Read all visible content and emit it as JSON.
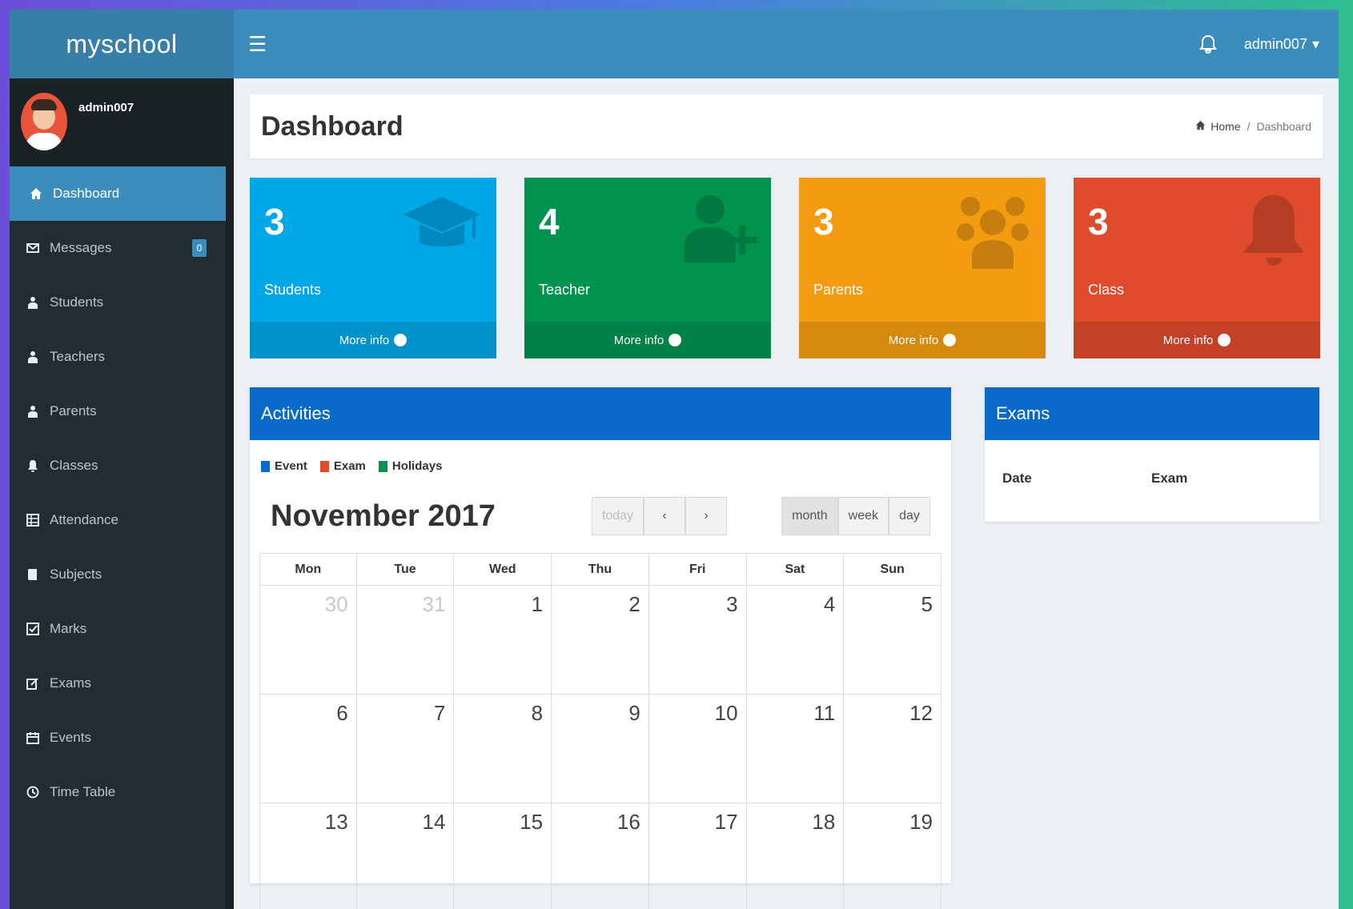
{
  "app": {
    "logo": "myschool"
  },
  "header": {
    "user_label": "admin007"
  },
  "sidebar": {
    "user_name": "admin007",
    "items": [
      {
        "label": "Dashboard",
        "icon": "home-icon",
        "active": true
      },
      {
        "label": "Messages",
        "icon": "envelope-icon",
        "badge": "0"
      },
      {
        "label": "Students",
        "icon": "user-icon"
      },
      {
        "label": "Teachers",
        "icon": "user-icon"
      },
      {
        "label": "Parents",
        "icon": "user-icon"
      },
      {
        "label": "Classes",
        "icon": "bell-icon"
      },
      {
        "label": "Attendance",
        "icon": "table-icon"
      },
      {
        "label": "Subjects",
        "icon": "book-icon"
      },
      {
        "label": "Marks",
        "icon": "check-square-icon"
      },
      {
        "label": "Exams",
        "icon": "edit-icon"
      },
      {
        "label": "Events",
        "icon": "calendar-icon"
      },
      {
        "label": "Time Table",
        "icon": "clock-icon"
      }
    ]
  },
  "page": {
    "title": "Dashboard",
    "breadcrumb": {
      "home": "Home",
      "current": "Dashboard"
    }
  },
  "stats": [
    {
      "value": "3",
      "label": "Students",
      "link": "More info",
      "color": "#00a7e8",
      "icon": "graduation-cap-icon"
    },
    {
      "value": "4",
      "label": "Teacher",
      "link": "More info",
      "color": "#00934f",
      "icon": "user-plus-icon"
    },
    {
      "value": "3",
      "label": "Parents",
      "link": "More info",
      "color": "#f39c12",
      "icon": "users-icon"
    },
    {
      "value": "3",
      "label": "Class",
      "link": "More info",
      "color": "#e04b2e",
      "icon": "bell-icon"
    }
  ],
  "activities": {
    "title": "Activities",
    "legend": [
      {
        "label": "Event",
        "color": "#0a6ac9"
      },
      {
        "label": "Exam",
        "color": "#e04b2e"
      },
      {
        "label": "Holidays",
        "color": "#00934f"
      }
    ],
    "calendar": {
      "title": "November 2017",
      "today_label": "today",
      "views": [
        "month",
        "week",
        "day"
      ],
      "days": [
        "Mon",
        "Tue",
        "Wed",
        "Thu",
        "Fri",
        "Sat",
        "Sun"
      ],
      "weeks": [
        [
          "30",
          "31",
          "1",
          "2",
          "3",
          "4",
          "5"
        ],
        [
          "6",
          "7",
          "8",
          "9",
          "10",
          "11",
          "12"
        ],
        [
          "13",
          "14",
          "15",
          "16",
          "17",
          "18",
          "19"
        ]
      ]
    }
  },
  "exams": {
    "title": "Exams",
    "columns": [
      "Date",
      "Exam"
    ]
  }
}
